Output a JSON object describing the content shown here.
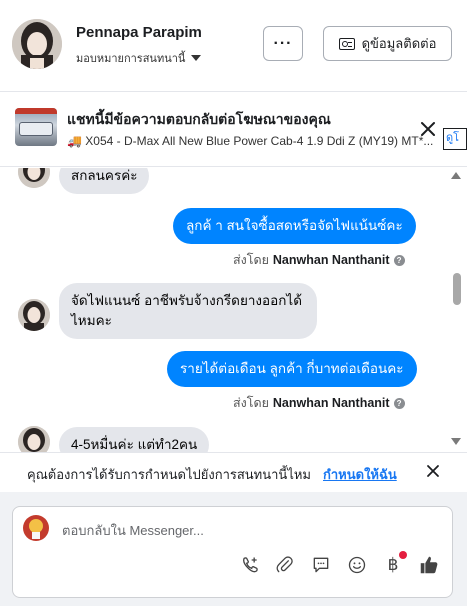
{
  "header": {
    "name": "Pennapa Parapim",
    "assign_label": "มอบหมายการสนทนานี้",
    "more_label": "···",
    "contact_label": "ดูข้อมูลติดต่อ"
  },
  "ad": {
    "title": "แชทนี้มีข้อความตอบกลับต่อโฆษณาของคุณ",
    "subtitle": "🚚 X054 - D-Max All New Blue Power Cab-4 1.9 Ddi Z (MY19) MT*...",
    "link_label": "ดูโ"
  },
  "messages": [
    {
      "dir": "in",
      "text": "สกลนครค่ะ"
    },
    {
      "dir": "out",
      "text": "ลูกค้ า สนใจซื้อสดหรือจัดไฟแน้นซ์คะ"
    },
    {
      "sent_prefix": "ส่งโดย",
      "sent_by": "Nanwhan Nanthanit"
    },
    {
      "dir": "in",
      "line1": "จัดไฟแนนซ์ อาชีพรับจ้างกรีดยางออกได้",
      "line2": "ไหมคะ"
    },
    {
      "dir": "out",
      "text": "รายได้ต่อเดือน ลูกค้า   กี่บาทต่อเดือนคะ"
    },
    {
      "sent_prefix": "ส่งโดย",
      "sent_by": "Nanwhan Nanthanit"
    },
    {
      "dir": "in",
      "text": "4-5หมื่นค่ะ แต่ทำ2คน"
    }
  ],
  "notice": {
    "text": "คุณต้องการได้รับการกำหนดไปยังการสนทนานี้ไหม",
    "link": "กำหนดให้ฉัน"
  },
  "composer": {
    "placeholder": "ตอบกลับใน Messenger...",
    "tools": [
      "phone-plus-icon",
      "paperclip-icon",
      "saved-reply-icon",
      "emoji-icon",
      "baht-payment-icon",
      "thumbs-up-icon"
    ]
  },
  "colors": {
    "outgoing_bubble": "#0084ff",
    "incoming_bubble": "#e4e6eb",
    "link": "#1877f2"
  }
}
